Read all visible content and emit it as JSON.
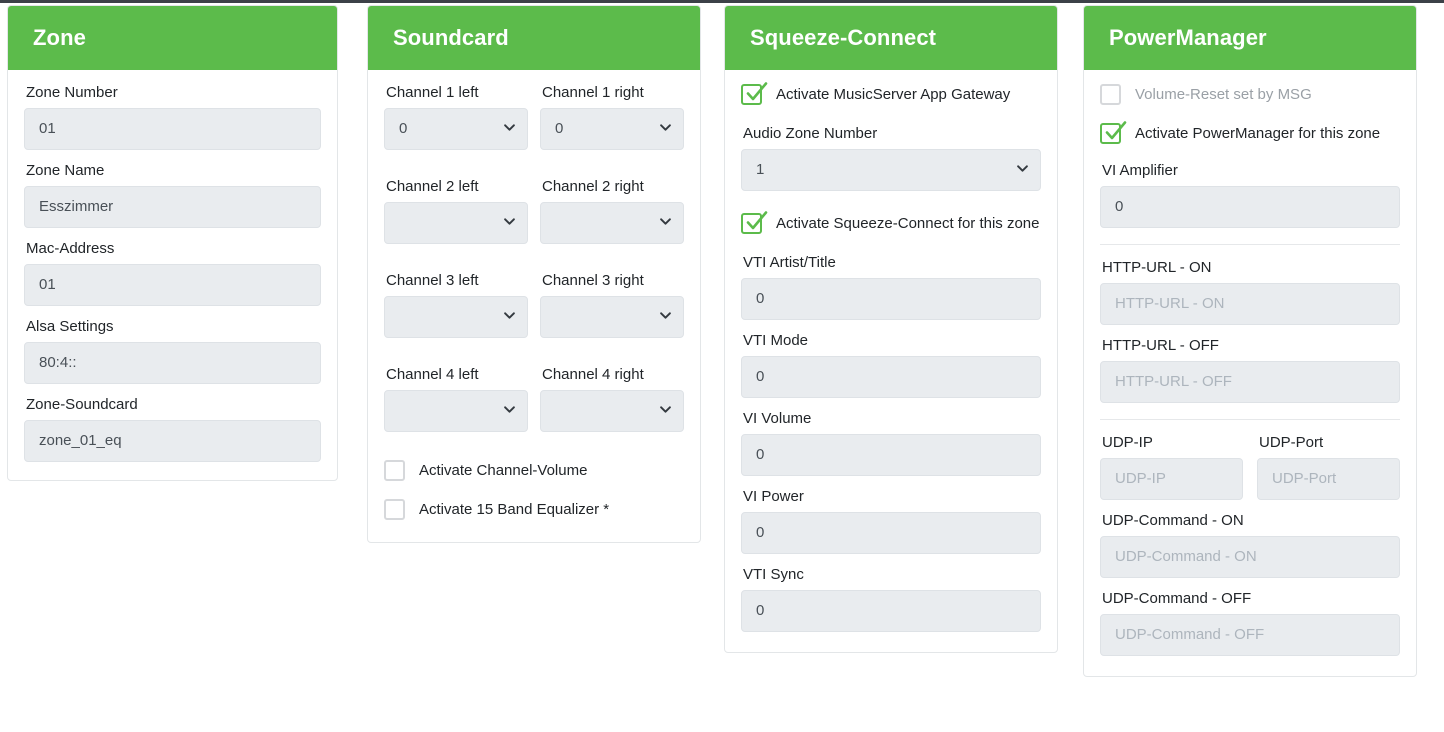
{
  "colors": {
    "header_green": "#5cbb4b",
    "check_green": "#5cbb4b",
    "input_bg": "#e9ecef",
    "placeholder": "#adb5bd"
  },
  "cards": {
    "zone": {
      "title": "Zone",
      "fields": [
        {
          "label": "Zone Number",
          "value": "01"
        },
        {
          "label": "Zone Name",
          "value": "Esszimmer"
        },
        {
          "label": "Mac-Address",
          "value": "01"
        },
        {
          "label": "Alsa Settings",
          "value": "80:4::"
        },
        {
          "label": "Zone-Soundcard",
          "value": "zone_01_eq"
        }
      ]
    },
    "soundcard": {
      "title": "Soundcard",
      "channels": [
        {
          "left_label": "Channel 1 left",
          "left_value": "0",
          "right_label": "Channel 1 right",
          "right_value": "0"
        },
        {
          "left_label": "Channel 2 left",
          "left_value": "",
          "right_label": "Channel 2 right",
          "right_value": ""
        },
        {
          "left_label": "Channel 3 left",
          "left_value": "",
          "right_label": "Channel 3 right",
          "right_value": ""
        },
        {
          "left_label": "Channel 4 left",
          "left_value": "",
          "right_label": "Channel 4 right",
          "right_value": ""
        }
      ],
      "checkboxes": [
        {
          "label": "Activate Channel-Volume",
          "checked": false
        },
        {
          "label": "Activate 15 Band Equalizer *",
          "checked": false
        }
      ]
    },
    "squeeze": {
      "title": "Squeeze-Connect",
      "gateway_checkbox": {
        "label": "Activate MusicServer App Gateway",
        "checked": true
      },
      "audio_zone": {
        "label": "Audio Zone Number",
        "value": "1"
      },
      "activate_checkbox": {
        "label": "Activate Squeeze-Connect for this zone",
        "checked": true
      },
      "fields": [
        {
          "label": "VTI Artist/Title",
          "value": "0"
        },
        {
          "label": "VTI Mode",
          "value": "0"
        },
        {
          "label": "VI Volume",
          "value": "0"
        },
        {
          "label": "VI Power",
          "value": "0"
        },
        {
          "label": "VTI Sync",
          "value": "0"
        }
      ]
    },
    "powermanager": {
      "title": "PowerManager",
      "volume_reset_checkbox": {
        "label": "Volume-Reset set by MSG",
        "checked": false,
        "disabled": true
      },
      "activate_checkbox": {
        "label": "Activate PowerManager for this zone",
        "checked": true
      },
      "amplifier": {
        "label": "VI Amplifier",
        "value": "0"
      },
      "http_on": {
        "label": "HTTP-URL - ON",
        "placeholder": "HTTP-URL - ON"
      },
      "http_off": {
        "label": "HTTP-URL - OFF",
        "placeholder": "HTTP-URL - OFF"
      },
      "udp_ip": {
        "label": "UDP-IP",
        "placeholder": "UDP-IP"
      },
      "udp_port": {
        "label": "UDP-Port",
        "placeholder": "UDP-Port"
      },
      "udp_cmd_on": {
        "label": "UDP-Command - ON",
        "placeholder": "UDP-Command - ON"
      },
      "udp_cmd_off": {
        "label": "UDP-Command - OFF",
        "placeholder": "UDP-Command - OFF"
      }
    }
  }
}
